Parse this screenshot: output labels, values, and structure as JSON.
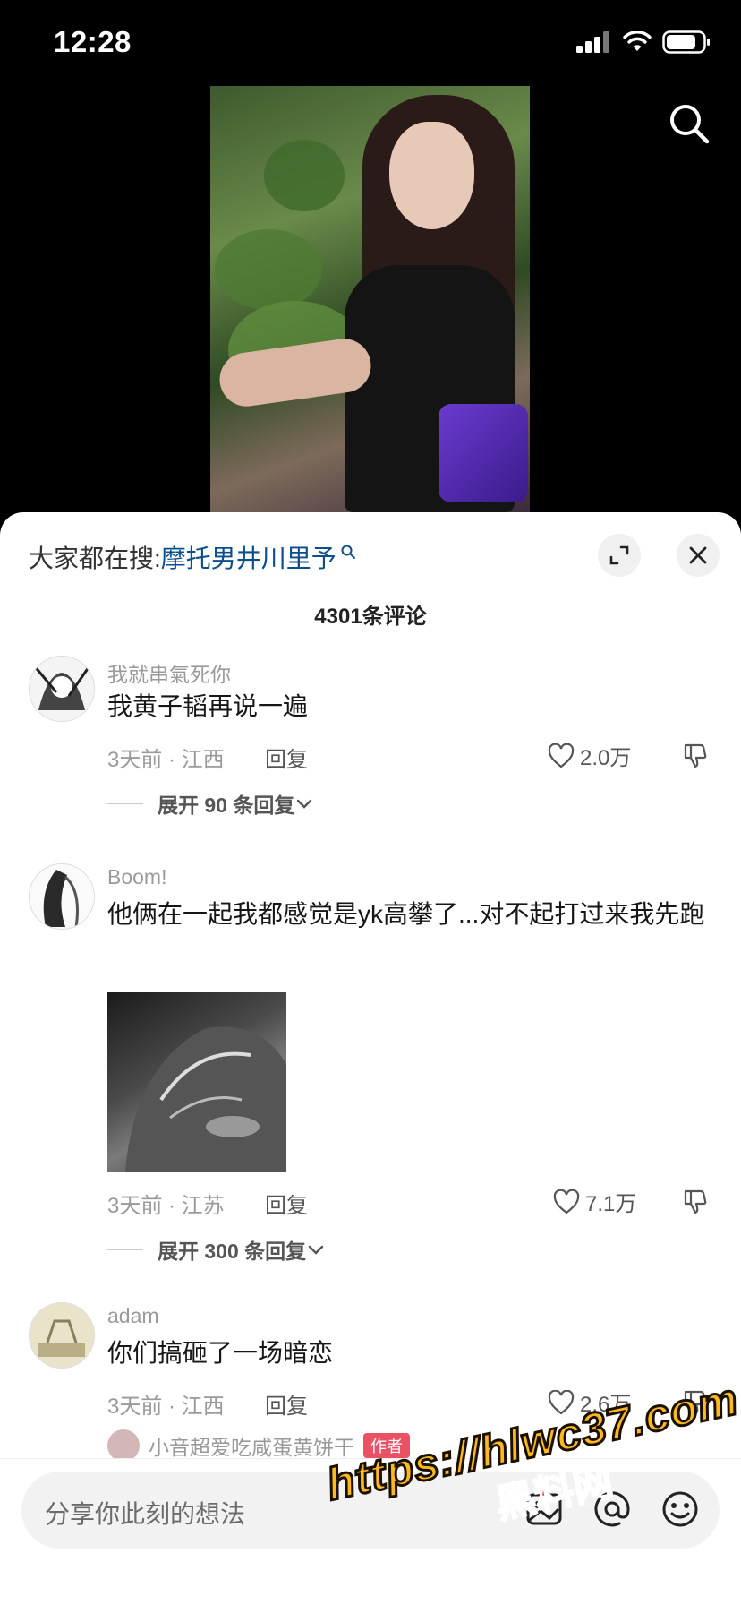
{
  "status": {
    "time": "12:28"
  },
  "video": {
    "description": "短视频画面"
  },
  "sheet": {
    "hot_prefix": "大家都在搜:",
    "hot_keyword": "摩托男井川里予",
    "comment_count": "4301条评论"
  },
  "comments": [
    {
      "user": "我就串氣死你",
      "text": "我黄子韬再说一遍",
      "time_loc": "3天前 · 江西",
      "reply": "回复",
      "likes": "2.0万",
      "expand": "展开 90 条回复"
    },
    {
      "user": "Boom!",
      "text": "他俩在一起我都感觉是yk高攀了...对不起打过来我先跑",
      "time_loc": "3天前 · 江苏",
      "reply": "回复",
      "likes": "7.1万",
      "expand": "展开 300 条回复"
    },
    {
      "user": "adam",
      "text": "你们搞砸了一场暗恋",
      "time_loc": "3天前 · 江西",
      "reply": "回复",
      "likes": "2.6万"
    }
  ],
  "partial_reply": {
    "user": "小音超爱吃咸蛋黄饼干",
    "tag": "作者"
  },
  "input": {
    "placeholder": "分享你此刻的想法"
  },
  "watermark": {
    "line1": "https://hlwc37.com",
    "line2": "黑料网"
  },
  "colors": {
    "keyword": "#0a4e8c",
    "author_tag": "#e8334b",
    "watermark": "#ffb81f"
  }
}
